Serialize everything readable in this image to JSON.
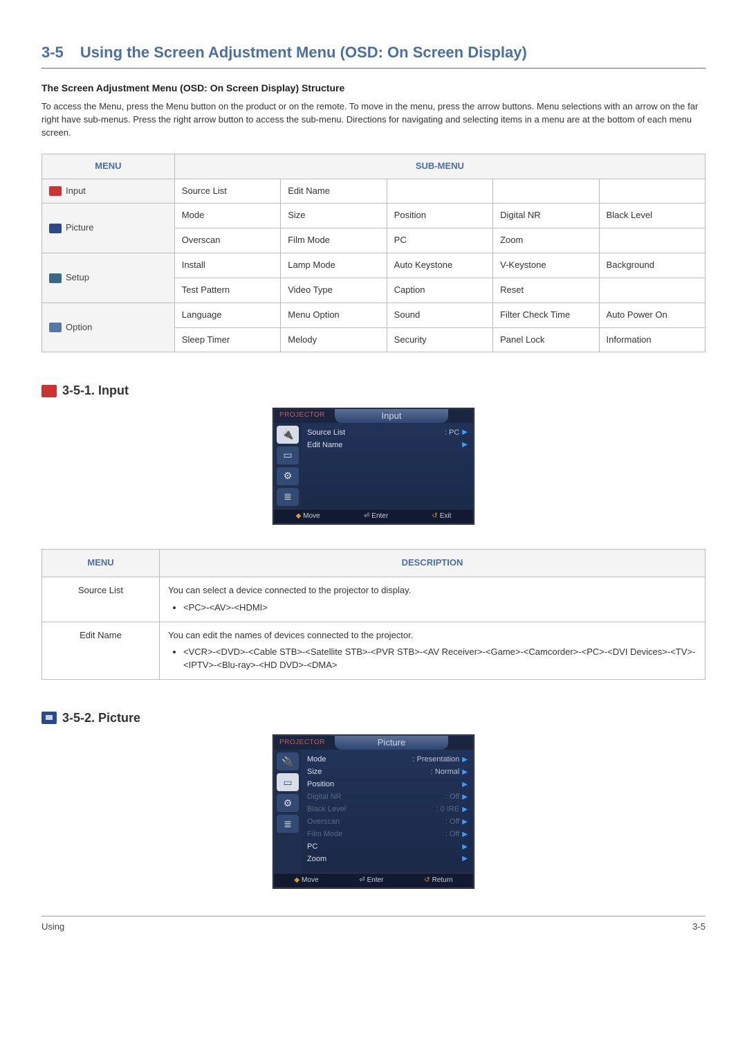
{
  "section": {
    "num": "3-5",
    "title": "Using the Screen Adjustment Menu (OSD: On Screen Display)"
  },
  "struct_head": "The Screen Adjustment Menu (OSD: On Screen Display) Structure",
  "intro": "To access the Menu, press the Menu button on the product or on the remote. To move in the menu, press the arrow buttons. Menu selections with an arrow on the far right have sub-menus. Press the right arrow button to access the sub-menu. Directions for navigating and selecting items in a menu are at the bottom of each menu screen.",
  "submenu_table": {
    "head_menu": "MENU",
    "head_sub": "SUB-MENU",
    "rows": [
      {
        "menu": "Input",
        "icon": "input",
        "cells": [
          [
            "Source List",
            "Edit Name",
            "",
            "",
            ""
          ]
        ]
      },
      {
        "menu": "Picture",
        "icon": "picture",
        "cells": [
          [
            "Mode",
            "Size",
            "Position",
            "Digital NR",
            "Black Level"
          ],
          [
            "Overscan",
            "Film Mode",
            "PC",
            "Zoom",
            ""
          ]
        ]
      },
      {
        "menu": "Setup",
        "icon": "setup",
        "cells": [
          [
            "Install",
            "Lamp Mode",
            "Auto Keystone",
            "V-Keystone",
            "Background"
          ],
          [
            "Test Pattern",
            "Video Type",
            "Caption",
            "Reset",
            ""
          ]
        ]
      },
      {
        "menu": "Option",
        "icon": "option",
        "cells": [
          [
            "Language",
            "Menu Option",
            "Sound",
            "Filter Check Time",
            "Auto Power On"
          ],
          [
            "Sleep Timer",
            "Melody",
            "Security",
            "Panel Lock",
            "Information"
          ]
        ]
      }
    ]
  },
  "sub1": {
    "heading": "3-5-1. Input",
    "osd": {
      "projector": "PROJECTOR",
      "tab": "Input",
      "items": [
        {
          "lbl": "Source List",
          "val": ": PC",
          "dis": false
        },
        {
          "lbl": "Edit Name",
          "val": "",
          "dis": false
        }
      ],
      "footer": {
        "move": "Move",
        "enter": "Enter",
        "right": "Exit"
      }
    },
    "desc": {
      "head_menu": "MENU",
      "head_desc": "DESCRIPTION",
      "rows": [
        {
          "k": "Source List",
          "txt": "You can select a device connected to the projector to display.",
          "bullet": "<PC>-<AV>-<HDMI>"
        },
        {
          "k": "Edit Name",
          "txt": "You can edit the names of devices connected to the projector.",
          "bullet": "<VCR>-<DVD>-<Cable STB>-<Satellite STB>-<PVR STB>-<AV Receiver>-<Game>-<Camcorder>-<PC>-<DVI Devices>-<TV>-<IPTV>-<Blu-ray>-<HD DVD>-<DMA>"
        }
      ]
    }
  },
  "sub2": {
    "heading": "3-5-2. Picture",
    "osd": {
      "projector": "PROJECTOR",
      "tab": "Picture",
      "items": [
        {
          "lbl": "Mode",
          "val": ": Presentation",
          "dis": false
        },
        {
          "lbl": "Size",
          "val": ": Normal",
          "dis": false
        },
        {
          "lbl": "Position",
          "val": "",
          "dis": false
        },
        {
          "lbl": "Digital NR",
          "val": ": Off",
          "dis": true
        },
        {
          "lbl": "Black Level",
          "val": ": 0 IRE",
          "dis": true
        },
        {
          "lbl": "Overscan",
          "val": ": Off",
          "dis": true
        },
        {
          "lbl": "Film Mode",
          "val": ": Off",
          "dis": true
        },
        {
          "lbl": "PC",
          "val": "",
          "dis": false
        },
        {
          "lbl": "Zoom",
          "val": "",
          "dis": false
        }
      ],
      "footer": {
        "move": "Move",
        "enter": "Enter",
        "right": "Return"
      }
    }
  },
  "footer": {
    "left": "Using",
    "right": "3-5"
  }
}
